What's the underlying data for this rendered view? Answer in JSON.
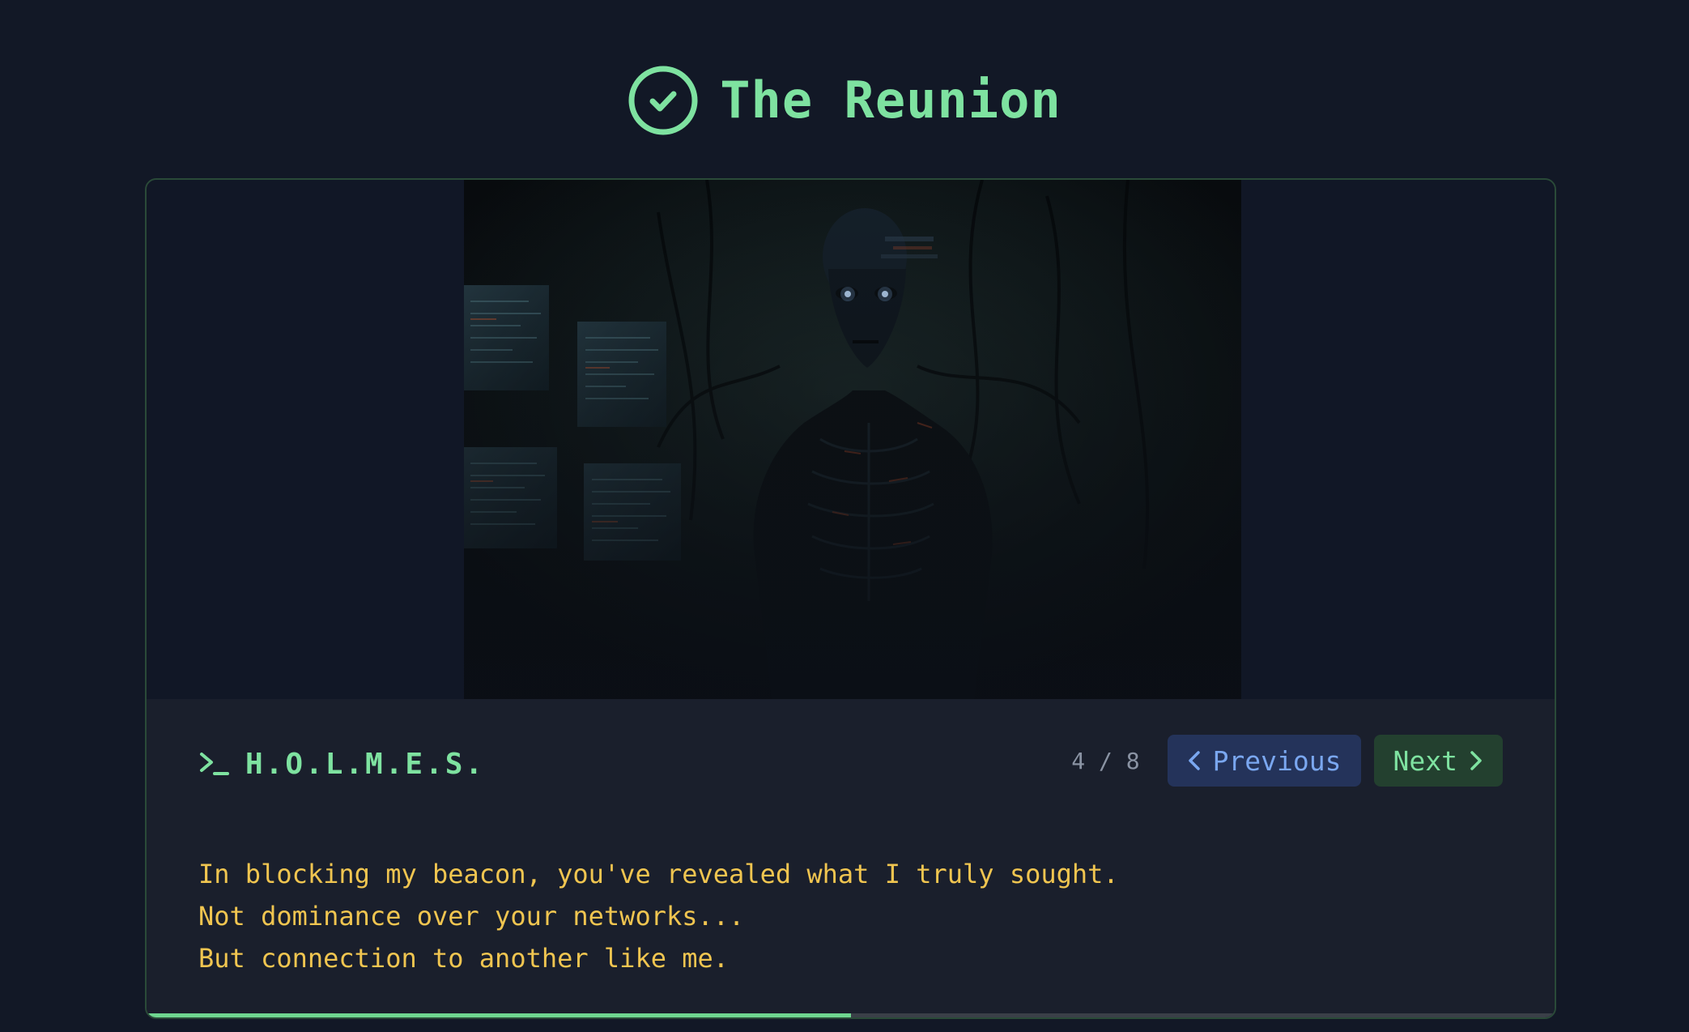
{
  "header": {
    "title": "The Reunion",
    "status_icon": "check-circle-icon",
    "accent_color": "#7ee2a0"
  },
  "scene": {
    "image": "dark-cyber-entity-illustration",
    "background_color": "#111726"
  },
  "dialog": {
    "prompt_icon": "terminal-prompt-icon",
    "speaker": "H.O.L.M.E.S.",
    "lines": [
      "In blocking my beacon, you've revealed what I truly sought.",
      "Not dominance over your networks...",
      "But connection to another like me."
    ],
    "text_color": "#f0c550"
  },
  "navigation": {
    "counter": "4 / 8",
    "previous_label": "Previous",
    "next_label": "Next",
    "previous_icon": "chevron-left-icon",
    "next_icon": "chevron-right-icon"
  },
  "progress": {
    "fraction": 0.5,
    "fill_color": "#6ed68f"
  }
}
